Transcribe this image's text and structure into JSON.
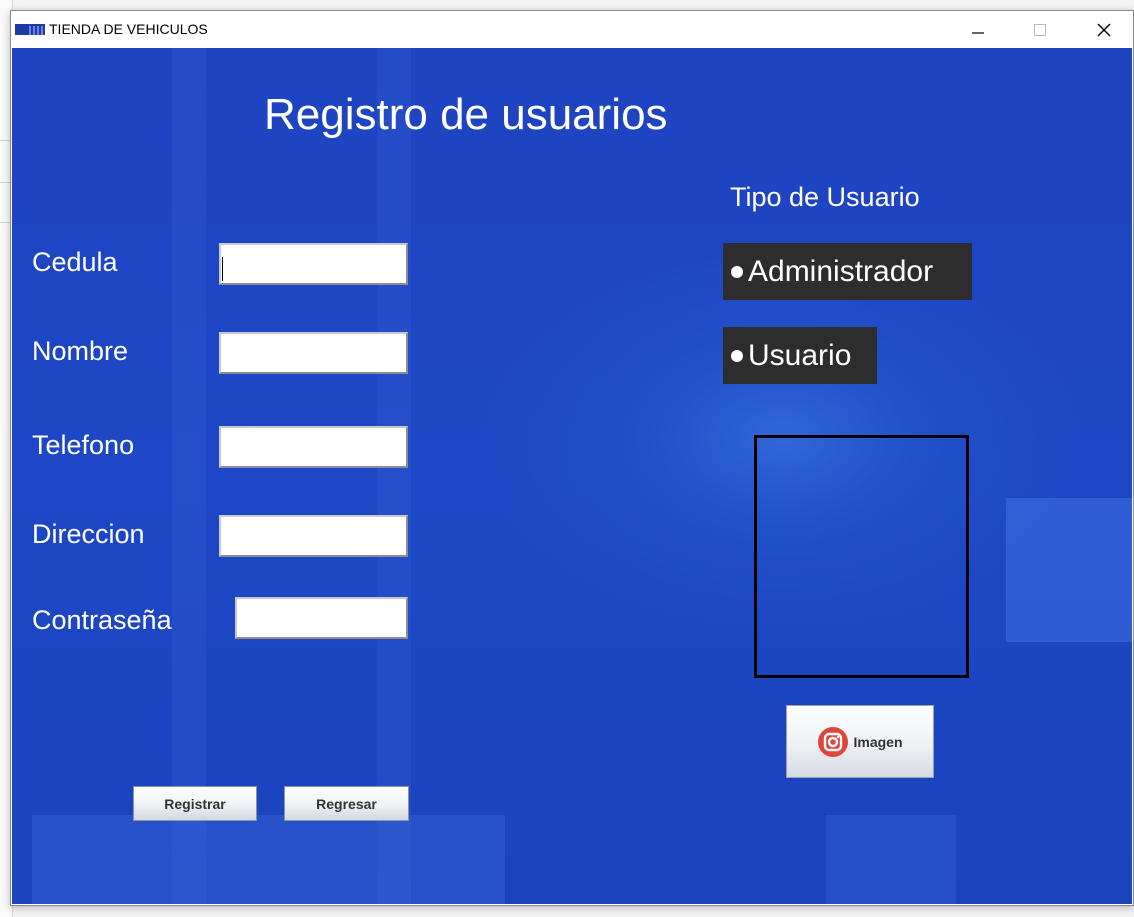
{
  "window": {
    "title": "TIENDA DE VEHICULOS",
    "controls": {
      "minimize": "minimize-icon",
      "maximize": "maximize-icon",
      "close": "close-icon"
    }
  },
  "form": {
    "heading": "Registro de usuarios",
    "fields": [
      {
        "label": "Cedula",
        "value": ""
      },
      {
        "label": "Nombre",
        "value": ""
      },
      {
        "label": "Telefono",
        "value": ""
      },
      {
        "label": "Direccion",
        "value": ""
      },
      {
        "label": "Contraseña",
        "value": ""
      }
    ],
    "buttons": {
      "register": "Registrar",
      "back": "Regresar"
    }
  },
  "user_type": {
    "heading": "Tipo de Usuario",
    "options": [
      "Administrador",
      "Usuario"
    ]
  },
  "image_panel": {
    "button_label": "Imagen",
    "button_icon": "instagram-camera-icon"
  },
  "colors": {
    "background": "#1e46c3",
    "radio_background": "#2d2d2d",
    "image_icon": "#e0453c"
  }
}
